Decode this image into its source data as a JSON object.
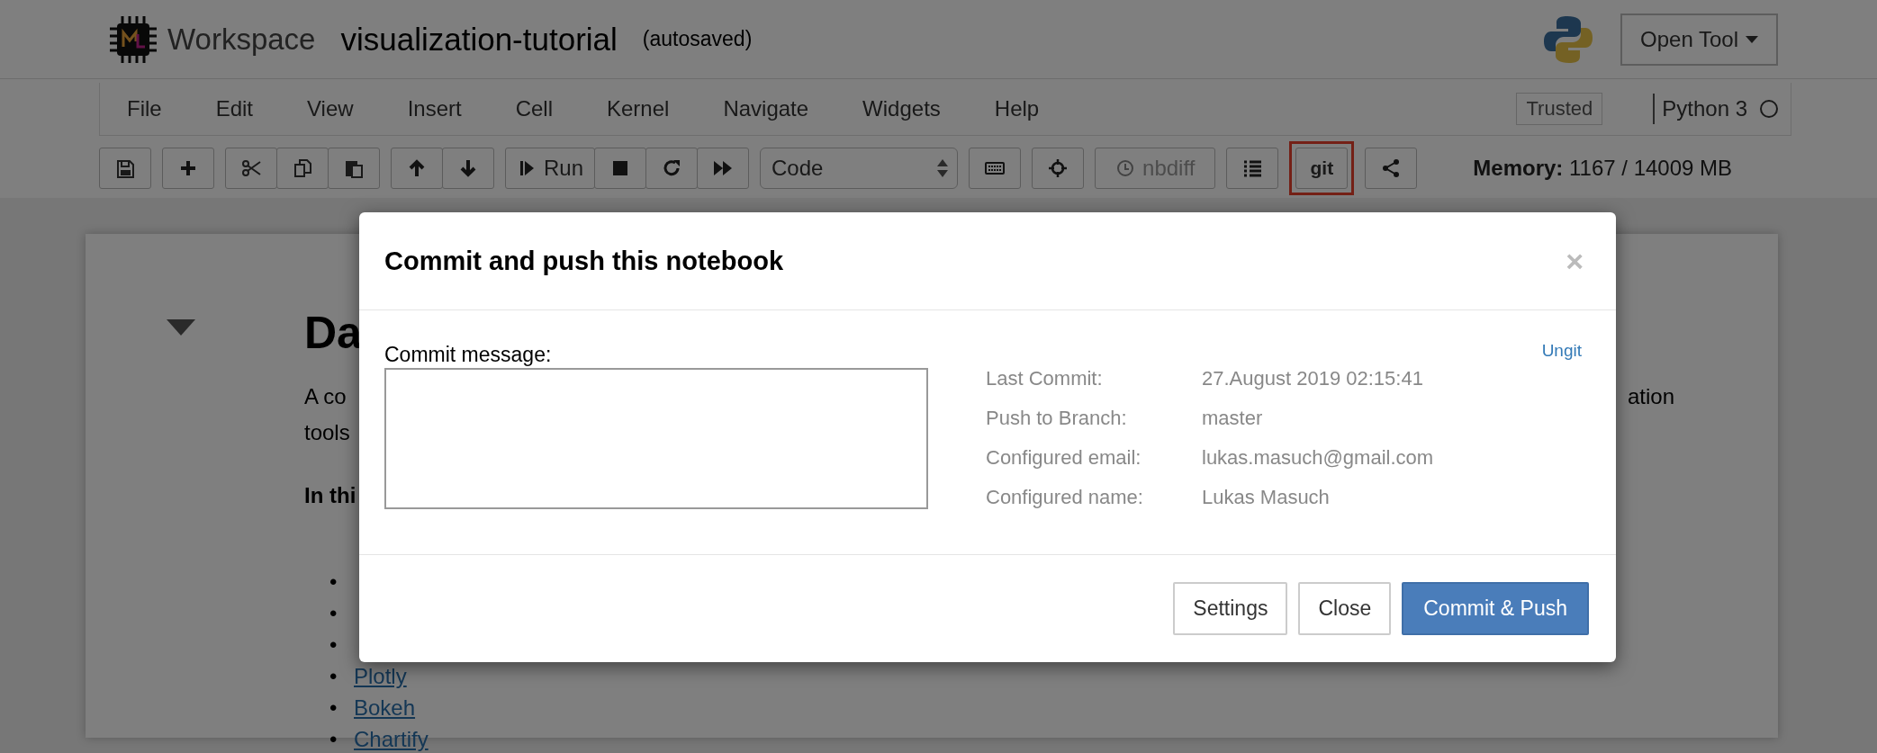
{
  "header": {
    "brand": "Workspace",
    "notebook_title": "visualization-tutorial",
    "save_status": "(autosaved)",
    "open_tool": "Open Tool"
  },
  "menu": [
    "File",
    "Edit",
    "View",
    "Insert",
    "Cell",
    "Kernel",
    "Navigate",
    "Widgets",
    "Help"
  ],
  "trusted": "Trusted",
  "kernel": {
    "name": "Python 3",
    "busy": false
  },
  "toolbar": [
    [
      {
        "kind": "icon"
      }
    ],
    [
      {
        "kind": "icon"
      }
    ],
    [
      {
        "kind": "icon"
      },
      {
        "kind": "icon"
      },
      {
        "kind": "icon"
      }
    ],
    [
      {
        "kind": "icon"
      },
      {
        "kind": "icon"
      }
    ],
    [
      {
        "kind": "icon_label",
        "label": "Run"
      },
      {
        "kind": "icon"
      },
      {
        "kind": "icon"
      },
      {
        "kind": "icon"
      }
    ],
    [
      {
        "kind": "select",
        "value": "Code"
      }
    ],
    [
      {
        "kind": "icon"
      }
    ],
    [
      {
        "kind": "icon"
      }
    ],
    [
      {
        "kind": "icon_label",
        "label": "nbdiff",
        "disabled": true
      }
    ],
    [
      {
        "kind": "icon"
      }
    ],
    [
      {
        "kind": "label",
        "label": "git",
        "highlighted": true
      }
    ],
    [
      {
        "kind": "icon"
      }
    ]
  ],
  "memory": {
    "label": "Memory:",
    "value": "1167 / 14009 MB"
  },
  "notebook": {
    "heading": "Da",
    "para_lines": [
      "A co",
      "tools"
    ],
    "para_right": "ation",
    "subheading": "In thi",
    "list": [
      {
        "bullet": "•"
      },
      {
        "bullet": "•"
      },
      {
        "bullet": "•"
      },
      {
        "bullet": "•",
        "link": "Plotly"
      },
      {
        "bullet": "•",
        "link": "Bokeh"
      },
      {
        "bullet": "•",
        "link": "Chartify"
      }
    ]
  },
  "modal": {
    "title": "Commit and push this notebook",
    "close": "×",
    "message_label": "Commit message:",
    "link": "Ungit",
    "info": [
      {
        "label": "Last Commit:",
        "value": "27.August 2019 02:15:41"
      },
      {
        "label": "Push to Branch:",
        "value": "master"
      },
      {
        "label": "Configured email:",
        "value": "lukas.masuch@gmail.com"
      },
      {
        "label": "Configured name:",
        "value": "Lukas Masuch"
      }
    ],
    "buttons": [
      {
        "label": "Settings",
        "kind": "default"
      },
      {
        "label": "Close",
        "kind": "default"
      },
      {
        "label": "Commit & Push",
        "kind": "primary"
      }
    ]
  }
}
